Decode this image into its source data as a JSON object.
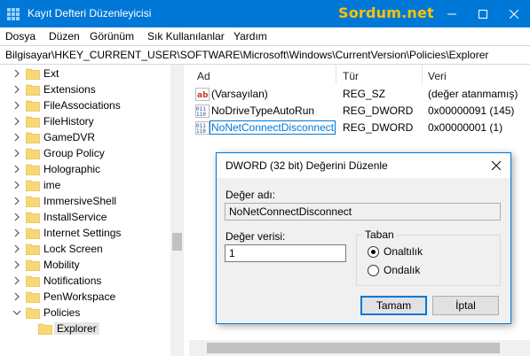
{
  "window": {
    "title": "Kayıt Defteri Düzenleyicisi",
    "brand": "Sordum.net"
  },
  "menu": [
    "Dosya",
    "Düzen",
    "Görünüm",
    "Sık Kullanılanlar",
    "Yardım"
  ],
  "address": "Bilgisayar\\HKEY_CURRENT_USER\\SOFTWARE\\Microsoft\\Windows\\CurrentVersion\\Policies\\Explorer",
  "tree": {
    "items": [
      {
        "label": "Ext",
        "expanded": false
      },
      {
        "label": "Extensions",
        "expanded": false
      },
      {
        "label": "FileAssociations",
        "expanded": false
      },
      {
        "label": "FileHistory",
        "expanded": false
      },
      {
        "label": "GameDVR",
        "expanded": false
      },
      {
        "label": "Group Policy",
        "expanded": false
      },
      {
        "label": "Holographic",
        "expanded": false
      },
      {
        "label": "ime",
        "expanded": false
      },
      {
        "label": "ImmersiveShell",
        "expanded": false
      },
      {
        "label": "InstallService",
        "expanded": false
      },
      {
        "label": "Internet Settings",
        "expanded": false
      },
      {
        "label": "Lock Screen",
        "expanded": false
      },
      {
        "label": "Mobility",
        "expanded": false
      },
      {
        "label": "Notifications",
        "expanded": false
      },
      {
        "label": "PenWorkspace",
        "expanded": false
      },
      {
        "label": "Policies",
        "expanded": true
      },
      {
        "label": "Explorer",
        "expanded": null,
        "selected": true
      }
    ]
  },
  "list": {
    "columns": [
      "Ad",
      "Tür",
      "Veri"
    ],
    "rows": [
      {
        "icon": "string-value-icon",
        "name": "(Varsayılan)",
        "type": "REG_SZ",
        "data": "(değer atanmamış)"
      },
      {
        "icon": "dword-value-icon",
        "name": "NoDriveTypeAutoRun",
        "type": "REG_DWORD",
        "data": "0x00000091 (145)"
      },
      {
        "icon": "dword-value-icon",
        "name": "NoNetConnectDisconnect",
        "type": "REG_DWORD",
        "data": "0x00000001 (1)",
        "selected": true
      }
    ]
  },
  "dialog": {
    "title": "DWORD (32 bit) Değerini Düzenle",
    "name_label": "Değer adı:",
    "name_value": "NoNetConnectDisconnect",
    "data_label": "Değer verisi:",
    "data_value": "1",
    "radix_label": "Taban",
    "hex_label": "Onaltılık",
    "dec_label": "Ondalık",
    "hex_selected": true,
    "ok_label": "Tamam",
    "cancel_label": "İptal"
  },
  "colors": {
    "titlebar": "#0078d7",
    "brand": "#ffc300",
    "folder": "#f8d775"
  }
}
